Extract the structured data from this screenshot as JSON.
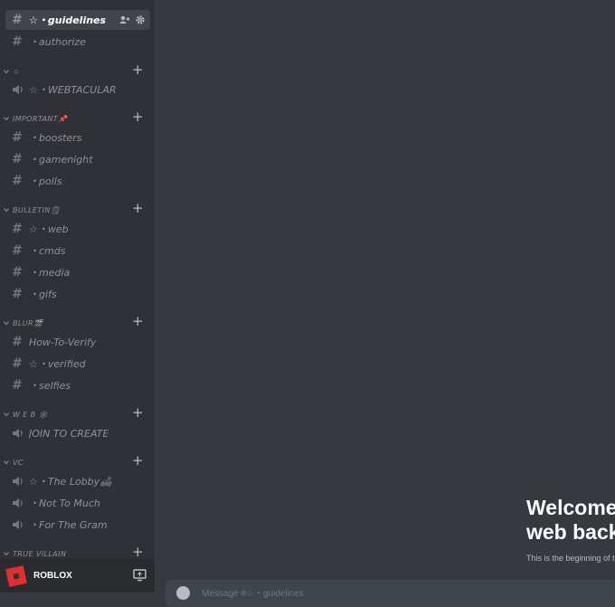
{
  "sidebar": {
    "top_channels": [
      {
        "label": "☆・guidelines",
        "icon": "hashtag-icon",
        "active": true
      },
      {
        "label": "・authorize",
        "icon": "hashtag-icon",
        "active": false
      }
    ],
    "categories": [
      {
        "label": "☆",
        "channels": [
          {
            "label": "☆・WEBTACULAR",
            "icon": "speaker-icon"
          }
        ]
      },
      {
        "label": "IMPORTANT📌",
        "channels": [
          {
            "label": "・boosters",
            "icon": "hashtag-icon"
          },
          {
            "label": "・gamenight",
            "icon": "hashtag-icon"
          },
          {
            "label": "・polls",
            "icon": "hashtag-icon"
          }
        ]
      },
      {
        "label": "BULLETIN🗒",
        "channels": [
          {
            "label": "☆・web",
            "icon": "hashtag-icon"
          },
          {
            "label": "・cmds",
            "icon": "hashtag-icon"
          },
          {
            "label": "・media",
            "icon": "hashtag-icon"
          },
          {
            "label": "・gifs",
            "icon": "hashtag-icon"
          }
        ]
      },
      {
        "label": "BLUR🎬",
        "channels": [
          {
            "label": "How-To-Verify",
            "icon": "hashtag-icon"
          },
          {
            "label": "☆・verified",
            "icon": "hashtag-icon"
          },
          {
            "label": "・selfies",
            "icon": "hashtag-icon"
          }
        ]
      },
      {
        "label": "W E B 🕸",
        "channels": [
          {
            "label": "JOIN TO CREATE",
            "icon": "speaker-icon"
          }
        ]
      },
      {
        "label": "VC",
        "channels": [
          {
            "label": "☆・The Lobby🛋",
            "icon": "speaker-icon"
          },
          {
            "label": "・Not To Much",
            "icon": "speaker-icon"
          },
          {
            "label": "・For The Gram",
            "icon": "speaker-icon"
          }
        ]
      },
      {
        "label": "TRUE VILLAIN",
        "channels": []
      }
    ]
  },
  "user_panel": {
    "username": "ROBLOX"
  },
  "welcome": {
    "line1": "Welcome",
    "line2": "web back",
    "subtitle": "This is the beginning of t"
  },
  "composer": {
    "placeholder": "Message #☆・guidelines"
  },
  "colors": {
    "sidebar": "#2f3136",
    "main": "#36393f",
    "active_channel": "#40444b",
    "avatar": "#e02f2f"
  }
}
